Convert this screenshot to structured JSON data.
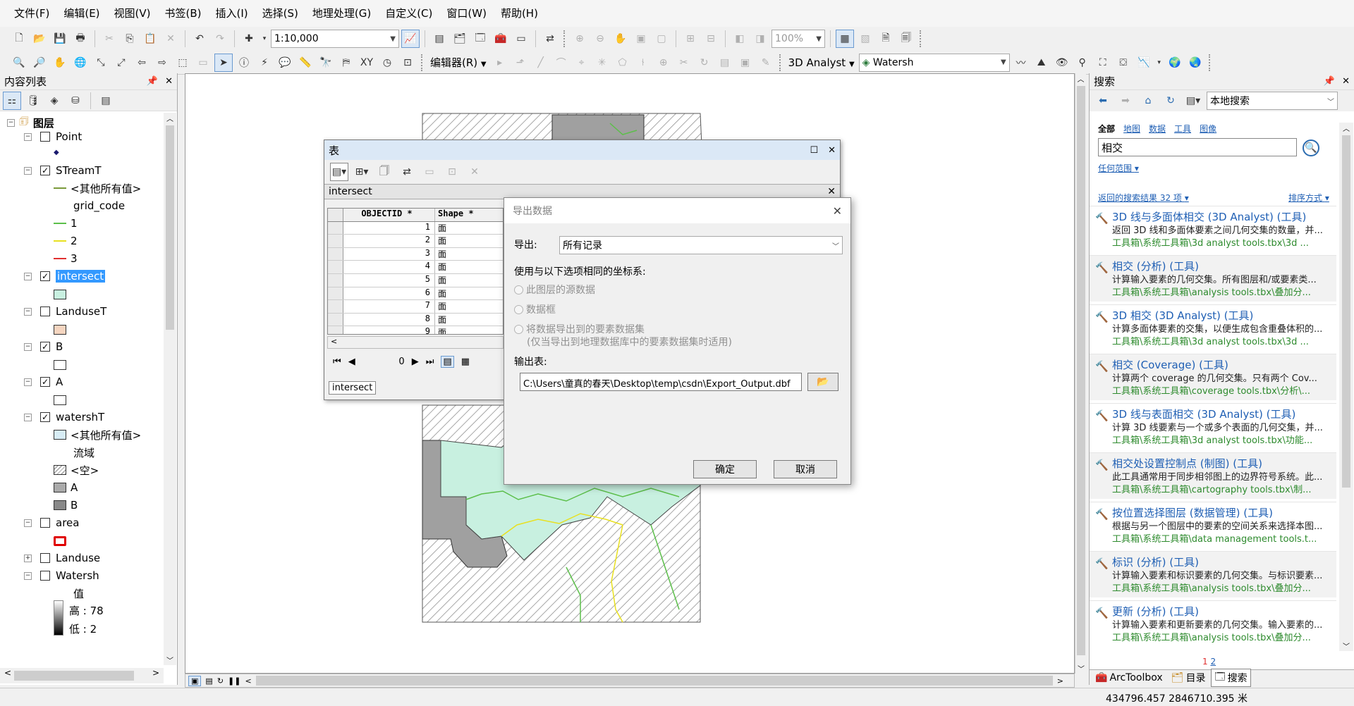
{
  "menu": [
    "文件(F)",
    "编辑(E)",
    "视图(V)",
    "书签(B)",
    "插入(I)",
    "选择(S)",
    "地理处理(G)",
    "自定义(C)",
    "窗口(W)",
    "帮助(H)"
  ],
  "toolbar": {
    "scale_value": "1:10,000",
    "zoom_value": "100%",
    "editor_label": "编辑器(R)",
    "analyst_label": "3D Analyst",
    "layer_combo": "Watersh"
  },
  "toc": {
    "title": "内容列表",
    "root": "图层",
    "layers": [
      {
        "name": "Point",
        "checked": false
      },
      {
        "name": "STreamT",
        "checked": true,
        "legend": [
          "<其他所有值>",
          "grid_code",
          "1",
          "2",
          "3"
        ]
      },
      {
        "name": "intersect",
        "checked": true
      },
      {
        "name": "LanduseT",
        "checked": false
      },
      {
        "name": "B",
        "checked": true
      },
      {
        "name": "A",
        "checked": true
      },
      {
        "name": "watershT",
        "checked": true,
        "legend": [
          "<其他所有值>",
          "流域",
          "<空>",
          "A",
          "B"
        ]
      },
      {
        "name": "area",
        "checked": false
      },
      {
        "name": "Landuse",
        "checked": false
      },
      {
        "name": "Watersh",
        "checked": false,
        "legend": [
          "值",
          "高 : 78",
          "低 : 2"
        ]
      }
    ]
  },
  "colors": {
    "selection": "#3399ff",
    "stream1": "#5cbf4a",
    "stream2": "#e8e020",
    "stream3": "#e03030",
    "intersect_fill": "#c8f0e0",
    "landuse_fill": "#f5d5c0",
    "area_outline": "#e00000",
    "link": "#1f5fb4",
    "path_green": "#2e8b2e"
  },
  "table_window": {
    "title": "表",
    "table_name": "intersect",
    "columns": [
      "OBJECTID *",
      "Shape *"
    ],
    "rows": [
      "1",
      "2",
      "3",
      "4",
      "5",
      "6",
      "7",
      "8",
      "9"
    ],
    "shape_glyph": "面",
    "record_pos": "0",
    "bottom_tab": "intersect"
  },
  "export_dialog": {
    "title": "导出数据",
    "export_label": "导出:",
    "export_value": "所有记录",
    "coord_label": "使用与以下选项相同的坐标系:",
    "opt1": "此图层的源数据",
    "opt2": "数据框",
    "opt3_line1": "将数据导出到的要素数据集",
    "opt3_line2": "(仅当导出到地理数据库中的要素数据集时适用)",
    "output_label": "输出表:",
    "output_path": "C:\\Users\\童真的春天\\Desktop\\temp\\csdn\\Export_Output.dbf",
    "ok": "确定",
    "cancel": "取消"
  },
  "search": {
    "title": "搜索",
    "location": "本地搜索",
    "cats": [
      "全部",
      "地图",
      "数据",
      "工具",
      "图像"
    ],
    "query": "相交",
    "scope": "任何范围",
    "result_count": "返回的搜索结果 32 项",
    "sort": "排序方式",
    "results": [
      {
        "t": "3D 线与多面体相交 (3D Analyst) (工具)",
        "d": "返回 3D 线和多面体要素之间几何交集的数量，并...",
        "p": "工具箱\\系统工具箱\\3d analyst tools.tbx\\3d ..."
      },
      {
        "t": "相交 (分析) (工具)",
        "d": "计算输入要素的几何交集。所有图层和/或要素类...",
        "p": "工具箱\\系统工具箱\\analysis tools.tbx\\叠加分..."
      },
      {
        "t": "3D 相交 (3D Analyst) (工具)",
        "d": "计算多面体要素的交集，以便生成包含重叠体积的...",
        "p": "工具箱\\系统工具箱\\3d analyst tools.tbx\\3d ..."
      },
      {
        "t": "相交 (Coverage) (工具)",
        "d": "计算两个 coverage 的几何交集。只有两个 Cov...",
        "p": "工具箱\\系统工具箱\\coverage tools.tbx\\分析\\..."
      },
      {
        "t": "3D 线与表面相交 (3D Analyst) (工具)",
        "d": "计算 3D 线要素与一个或多个表面的几何交集，并...",
        "p": "工具箱\\系统工具箱\\3d analyst tools.tbx\\功能..."
      },
      {
        "t": "相交处设置控制点 (制图) (工具)",
        "d": "此工具通常用于同步相邻图上的边界符号系统。此...",
        "p": "工具箱\\系统工具箱\\cartography tools.tbx\\制..."
      },
      {
        "t": "按位置选择图层 (数据管理) (工具)",
        "d": "根据与另一个图层中的要素的空间关系来选择本图...",
        "p": "工具箱\\系统工具箱\\data management tools.t..."
      },
      {
        "t": "标识 (分析) (工具)",
        "d": "计算输入要素和标识要素的几何交集。与标识要素...",
        "p": "工具箱\\系统工具箱\\analysis tools.tbx\\叠加分..."
      },
      {
        "t": "更新 (分析) (工具)",
        "d": "计算输入要素和更新要素的几何交集。输入要素的...",
        "p": "工具箱\\系统工具箱\\analysis tools.tbx\\叠加分..."
      }
    ],
    "pages": [
      "1",
      "2"
    ],
    "tabs": [
      "ArcToolbox",
      "目录",
      "搜索"
    ]
  },
  "status": {
    "coords": "434796.457  2846710.395 米"
  }
}
